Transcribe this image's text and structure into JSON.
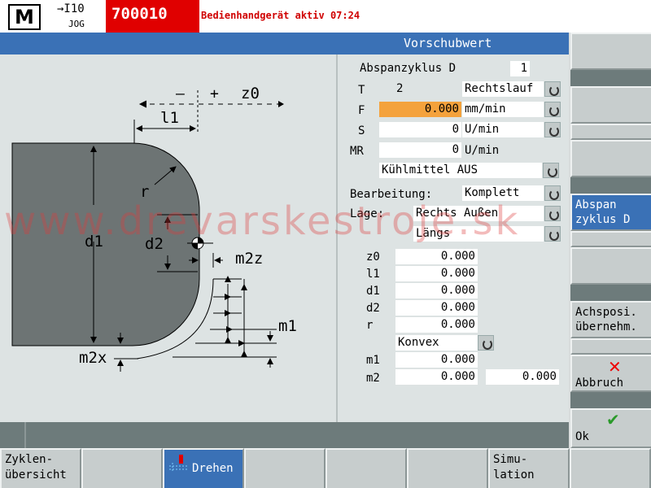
{
  "topbar": {
    "mode_logo": "M",
    "increment": "→I10",
    "mode": "JOG",
    "alarm_number": "700010",
    "alarm_text": "Bedienhandgerät aktiv 07:24"
  },
  "header": {
    "title": "Vorschubwert"
  },
  "graphic": {
    "labels": {
      "minus": "–",
      "plus": "+",
      "z0": "z0",
      "l1": "l1",
      "r": "r",
      "d1": "d1",
      "d2": "d2",
      "m2z": "m2z",
      "m1": "m1",
      "m2x": "m2x"
    }
  },
  "params": {
    "cycle_label": "Abspanzyklus D",
    "cycle_value": "1",
    "T_label": "T",
    "T_value": "2",
    "T_dir": "Rechtslauf",
    "F_label": "F",
    "F_value": "0.000",
    "F_unit": "mm/min",
    "S_label": "S",
    "S_value": "0",
    "S_unit": "U/min",
    "MR_label": "MR",
    "MR_value": "0",
    "MR_unit": "U/min",
    "coolant": "Kühlmittel AUS",
    "machining_label": "Bearbeitung:",
    "machining_value": "Komplett",
    "position_label": "Lage:",
    "position_value": "Rechts Außen",
    "direction_value": "Längs",
    "z0_label": "z0",
    "z0_value": "0.000",
    "l1_label": "l1",
    "l1_value": "0.000",
    "d1_label": "d1",
    "d1_value": "0.000",
    "d2_label": "d2",
    "d2_value": "0.000",
    "r_label": "r",
    "r_value": "0.000",
    "shape_value": "Konvex",
    "m1_label": "m1",
    "m1_value": "0.000",
    "m2_label": "m2",
    "m2_value_a": "0.000",
    "m2_value_b": "0.000"
  },
  "right_softkeys": {
    "abspan_line1": "Abspan",
    "abspan_line2": "zyklus D",
    "achs_line1": "Achsposi.",
    "achs_line2": "übernehm.",
    "cancel_label": "Abbruch",
    "ok_label": "Ok"
  },
  "bottom_softkeys": {
    "cycles_line1": "Zyklen-",
    "cycles_line2": "übersicht",
    "turning": "Drehen",
    "sim_line1": "Simu-",
    "sim_line2": "lation"
  },
  "watermark": "www.drevarskestroje.sk",
  "colors": {
    "header_blue": "#3a71b6",
    "alarm_red": "#e00000",
    "active_field": "#f4a23c",
    "panel": "#dde3e3"
  }
}
